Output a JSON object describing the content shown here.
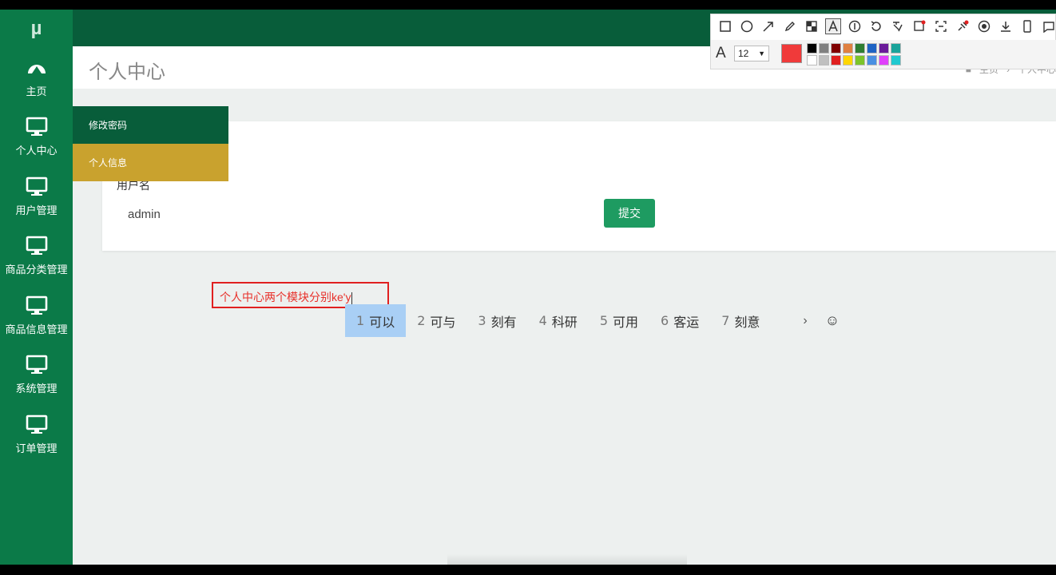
{
  "sidebar": {
    "logo": "µ",
    "items": [
      {
        "label": "主页",
        "icon": "dashboard-icon"
      },
      {
        "label": "个人中心",
        "icon": "monitor-icon"
      },
      {
        "label": "用户管理",
        "icon": "monitor-icon"
      },
      {
        "label": "商品分类管理",
        "icon": "monitor-icon"
      },
      {
        "label": "商品信息管理",
        "icon": "monitor-icon"
      },
      {
        "label": "系统管理",
        "icon": "monitor-icon"
      },
      {
        "label": "订单管理",
        "icon": "monitor-icon"
      }
    ]
  },
  "submenu": {
    "items": [
      {
        "label": "修改密码"
      },
      {
        "label": "个人信息"
      }
    ]
  },
  "titlebar": {
    "title": "个人中心",
    "breadcrumb": {
      "home": "主页",
      "sep": "›",
      "current": "个人中心"
    }
  },
  "form": {
    "username_label": "用户名",
    "username_value": "admin",
    "submit_label": "提交"
  },
  "annotation": {
    "text": "个人中心两个模块分别ke'y"
  },
  "ime": {
    "candidates": [
      {
        "num": "1",
        "text": "可以"
      },
      {
        "num": "2",
        "text": "可与"
      },
      {
        "num": "3",
        "text": "刻有"
      },
      {
        "num": "4",
        "text": "科研"
      },
      {
        "num": "5",
        "text": "可用"
      },
      {
        "num": "6",
        "text": "客运"
      },
      {
        "num": "7",
        "text": "刻意"
      }
    ],
    "next": "›",
    "emoji": "☺"
  },
  "snip_toolbar": {
    "font_letter": "A",
    "font_size": "12",
    "current_color": "#f03a3a",
    "palette": [
      "#000000",
      "#808080",
      "#800000",
      "#e08040",
      "#2e7d32",
      "#1e63c4",
      "#6a1b9a",
      "#1aa39a",
      "#ffffff",
      "#c0c0c0",
      "#e02020",
      "#ffd600",
      "#7cc42a",
      "#4a90e2",
      "#e040fb",
      "#20c9d0"
    ]
  },
  "colors": {
    "sidebar": "#0b7a48",
    "header": "#085d3a",
    "submenu_active": "#c9a22e",
    "button": "#1e9b61"
  }
}
